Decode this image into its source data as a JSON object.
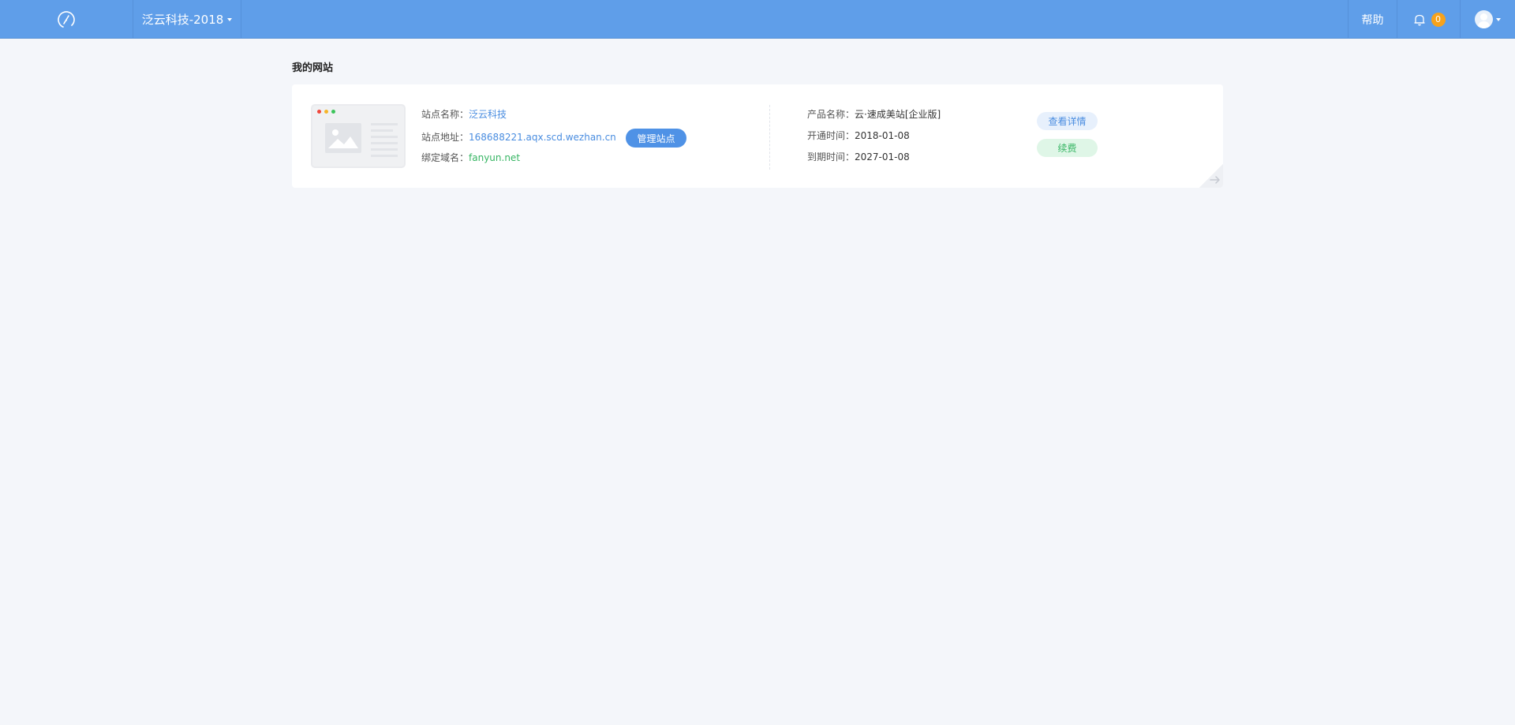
{
  "header": {
    "site_switch_label": "泛云科技-2018",
    "help_label": "帮助",
    "notification_count": "0"
  },
  "main": {
    "section_title": "我的网站",
    "site": {
      "name_label": "站点名称：",
      "name_value": "泛云科技",
      "address_label": "站点地址：",
      "address_value": "168688221.aqx.scd.wezhan.cn",
      "domain_label": "绑定域名：",
      "domain_value": "fanyun.net",
      "manage_button": "管理站点",
      "product_label": "产品名称：",
      "product_value": "云·速成美站[企业版]",
      "open_label": "开通时间：",
      "open_value": "2018-01-08",
      "expire_label": "到期时间：",
      "expire_value": "2027-01-08",
      "detail_button": "查看详情",
      "renew_button": "续费"
    }
  },
  "colors": {
    "topbar": "#5f9ee9",
    "accent_blue": "#4a8de0",
    "accent_green": "#36b563",
    "badge": "#f7a21b"
  },
  "icons": [
    "logo-icon",
    "caret-down-icon",
    "bell-icon",
    "avatar-icon",
    "arrow-right-icon"
  ]
}
